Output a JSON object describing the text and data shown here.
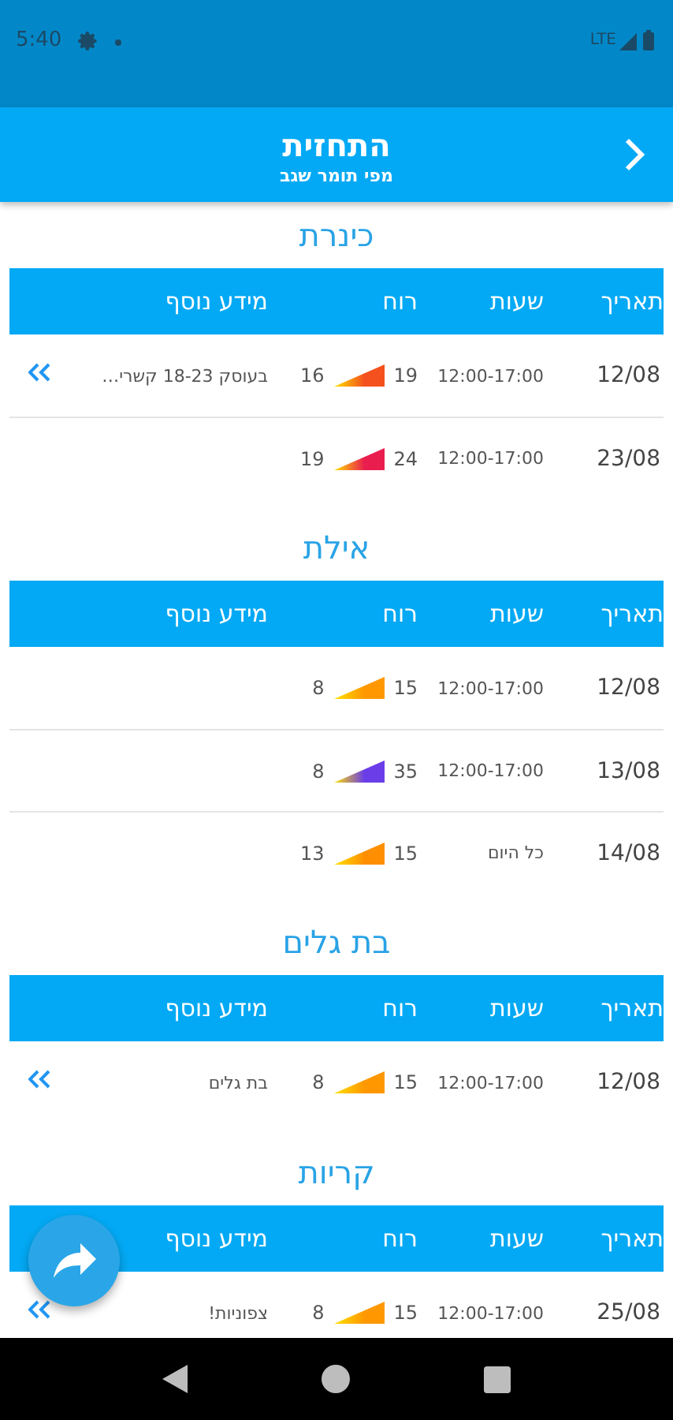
{
  "status_bar": {
    "time": "5:40",
    "network": "LTE"
  },
  "app_bar": {
    "title": "התחזית",
    "subtitle": "מפי תומר שגב"
  },
  "sections": [
    {
      "title": "כינרת",
      "columns": [
        "תאריך",
        "שעות",
        "רוח",
        "מידע נוסף"
      ],
      "rows": [
        {
          "date": "12/08",
          "hours": "12:00-17:00",
          "gust": "19",
          "base": "16",
          "color": "#f4511e",
          "info": "בעוסק 18-23 קשרי…",
          "more": true
        },
        {
          "date": "23/08",
          "hours": "12:00-17:00",
          "gust": "24",
          "base": "19",
          "color": "#e91e4f"
        }
      ]
    },
    {
      "title": "אילת",
      "columns": [
        "תאריך",
        "שעות",
        "רוח",
        "מידע נוסף"
      ],
      "rows": [
        {
          "date": "12/08",
          "hours": "12:00-17:00",
          "gust": "15",
          "base": "8",
          "color": "#ff9800"
        },
        {
          "date": "13/08",
          "hours": "12:00-17:00",
          "gust": "35",
          "base": "8",
          "color": "#6a3de8"
        },
        {
          "date": "14/08",
          "hours": "כל היום",
          "gust": "15",
          "base": "13",
          "color": "#ff8f00"
        }
      ]
    },
    {
      "title": "בת גלים",
      "columns": [
        "תאריך",
        "שעות",
        "רוח",
        "מידע נוסף"
      ],
      "rows": [
        {
          "date": "12/08",
          "hours": "12:00-17:00",
          "gust": "15",
          "base": "8",
          "color": "#ff9800",
          "info": "בת גלים",
          "more": true
        }
      ]
    },
    {
      "title": "קריות",
      "columns": [
        "תאריך",
        "שעות",
        "רוח",
        "מידע נוסף"
      ],
      "rows": [
        {
          "date": "25/08",
          "hours": "12:00-17:00",
          "gust": "15",
          "base": "8",
          "color": "#ff9800",
          "info": "צפוניות!",
          "more": true
        }
      ]
    }
  ]
}
